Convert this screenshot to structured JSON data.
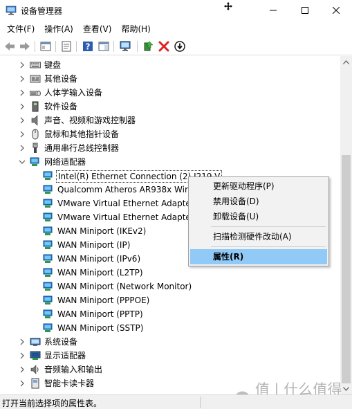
{
  "window": {
    "title": "设备管理器"
  },
  "menubar": {
    "items": [
      {
        "label": "文件(F)"
      },
      {
        "label": "操作(A)"
      },
      {
        "label": "查看(V)"
      },
      {
        "label": "帮助(H)"
      }
    ]
  },
  "toolbar": {
    "buttons": [
      "back-icon",
      "forward-icon",
      "tree-view-icon",
      "properties-sheet-icon",
      "help-icon",
      "action-pane-icon",
      "monitor-scan-icon",
      "update-driver-icon",
      "uninstall-icon",
      "download-icon"
    ]
  },
  "tree": {
    "categories_top": [
      {
        "label": "键盘",
        "icon": "keyboard-icon"
      },
      {
        "label": "其他设备",
        "icon": "unknown-device-icon"
      },
      {
        "label": "人体学输入设备",
        "icon": "hid-icon"
      },
      {
        "label": "软件设备",
        "icon": "software-device-icon"
      },
      {
        "label": "声音、视频和游戏控制器",
        "icon": "speaker-icon"
      },
      {
        "label": "鼠标和其他指针设备",
        "icon": "mouse-icon"
      },
      {
        "label": "通用串行总线控制器",
        "icon": "usb-icon"
      },
      {
        "label": "网络适配器",
        "icon": "network-adapter-icon"
      }
    ],
    "network_adapters": [
      {
        "label": "Intel(R) Ethernet Connection (2) I219-V"
      },
      {
        "label": "Qualcomm Atheros AR938x Wireless Network Adapter"
      },
      {
        "label": "VMware Virtual Ethernet Adapter for VMnet1"
      },
      {
        "label": "VMware Virtual Ethernet Adapter for VMnet8"
      },
      {
        "label": "WAN Miniport (IKEv2)"
      },
      {
        "label": "WAN Miniport (IP)"
      },
      {
        "label": "WAN Miniport (IPv6)"
      },
      {
        "label": "WAN Miniport (L2TP)"
      },
      {
        "label": "WAN Miniport (Network Monitor)"
      },
      {
        "label": "WAN Miniport (PPPOE)"
      },
      {
        "label": "WAN Miniport (PPTP)"
      },
      {
        "label": "WAN Miniport (SSTP)"
      }
    ],
    "categories_bottom": [
      {
        "label": "系统设备",
        "icon": "system-device-icon"
      },
      {
        "label": "显示适配器",
        "icon": "display-adapter-icon"
      },
      {
        "label": "音频输入和输出",
        "icon": "audio-icon"
      },
      {
        "label": "智能卡读卡器",
        "icon": "smart-card-icon"
      }
    ]
  },
  "context_menu": {
    "items": [
      {
        "label": "更新驱动程序(P)"
      },
      {
        "label": "禁用设备(D)"
      },
      {
        "label": "卸载设备(U)"
      },
      {
        "label": "扫描检测硬件改动(A)"
      },
      {
        "label": "属性(R)"
      }
    ],
    "highlight_color": "#91c9f7"
  },
  "statusbar": {
    "text": "打开当前选择项的属性表。"
  },
  "watermark": {
    "text": "值 | 什么值得买"
  },
  "colors": {
    "network_icon": "#1e88d6",
    "uninstall_red": "#e02020",
    "help_blue": "#2a5db0"
  }
}
